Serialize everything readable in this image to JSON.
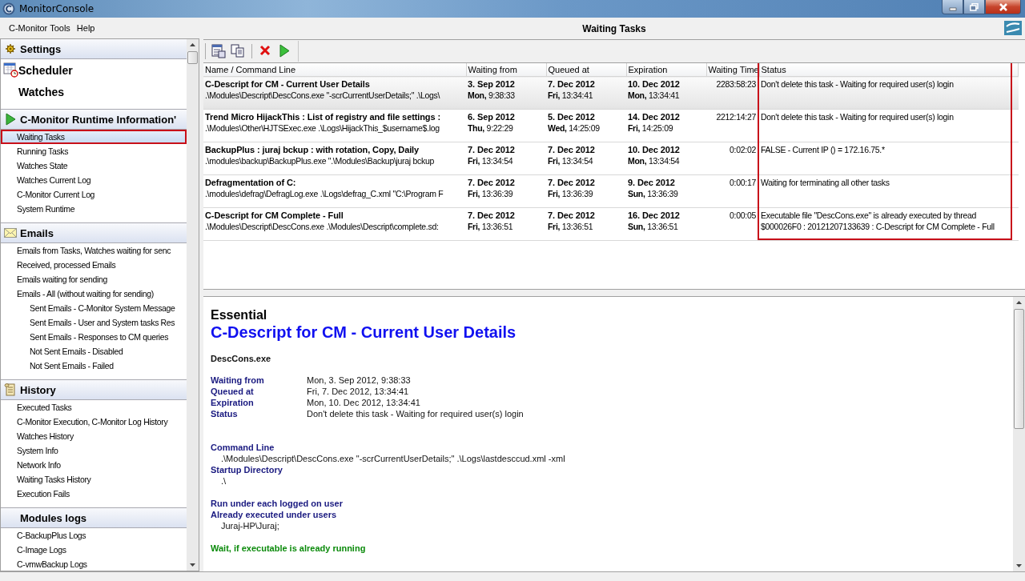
{
  "window": {
    "title": "MonitorConsole"
  },
  "menu": [
    "C-Monitor Tools",
    "Help"
  ],
  "sidebar": {
    "sections": [
      {
        "title": "Settings",
        "kind": "header"
      },
      {
        "title": "Scheduler",
        "kind": "link"
      },
      {
        "title": "Watches",
        "kind": "link"
      },
      {
        "title": "C-Monitor Runtime Information'",
        "kind": "header",
        "items": [
          {
            "label": "Waiting Tasks",
            "selected": true,
            "annotated": true
          },
          {
            "label": "Running Tasks",
            "selected": false,
            "annotated": false
          },
          {
            "label": "Watches State",
            "selected": false,
            "annotated": false
          },
          {
            "label": "Watches Current Log",
            "selected": false,
            "annotated": false
          },
          {
            "label": "C-Monitor Current Log",
            "selected": false,
            "annotated": false
          },
          {
            "label": "System Runtime",
            "selected": false,
            "annotated": false
          }
        ]
      },
      {
        "title": "Emails",
        "kind": "header",
        "items": [
          {
            "label": "Emails from Tasks, Watches waiting for senc",
            "selected": false,
            "annotated": false
          },
          {
            "label": "Received, processed Emails",
            "selected": false,
            "annotated": false
          },
          {
            "label": "Emails waiting for sending",
            "selected": false,
            "annotated": false
          },
          {
            "label": "Emails - All (without waiting for sending)",
            "selected": false,
            "annotated": false,
            "children": [
              {
                "label": "Sent Emails - C-Monitor System Message",
                "selected": false,
                "annotated": false
              },
              {
                "label": "Sent Emails - User and System tasks Res",
                "selected": false,
                "annotated": false
              },
              {
                "label": "Sent Emails - Responses to CM queries",
                "selected": false,
                "annotated": false
              },
              {
                "label": "Not Sent Emails - Disabled",
                "selected": false,
                "annotated": false
              },
              {
                "label": "Not Sent Emails - Failed",
                "selected": false,
                "annotated": false
              }
            ]
          }
        ]
      },
      {
        "title": "History",
        "kind": "header",
        "items": [
          {
            "label": "Executed Tasks",
            "selected": false,
            "annotated": false
          },
          {
            "label": "C-Monitor Execution, C-Monitor Log History",
            "selected": false,
            "annotated": false
          },
          {
            "label": "Watches History",
            "selected": false,
            "annotated": false
          },
          {
            "label": "System Info",
            "selected": false,
            "annotated": false
          },
          {
            "label": "Network Info",
            "selected": false,
            "annotated": false
          },
          {
            "label": "Waiting Tasks History",
            "selected": false,
            "annotated": false
          },
          {
            "label": "Execution Fails",
            "selected": false,
            "annotated": false
          }
        ]
      },
      {
        "title": "Modules logs",
        "kind": "header",
        "items": [
          {
            "label": "C-BackupPlus Logs",
            "selected": false,
            "annotated": false
          },
          {
            "label": "C-Image Logs",
            "selected": false,
            "annotated": false
          },
          {
            "label": "C-vmwBackup Logs",
            "selected": false,
            "annotated": false
          }
        ]
      }
    ]
  },
  "panel": {
    "title": "Waiting Tasks"
  },
  "toolbar": [
    {
      "kind": "properties"
    },
    {
      "kind": "copy"
    },
    {
      "kind": "delete"
    },
    {
      "kind": "run"
    }
  ],
  "table": {
    "columns": [
      {
        "label": "Name / Command Line",
        "annotated": false
      },
      {
        "label": "Waiting from",
        "annotated": false
      },
      {
        "label": "Queued at",
        "annotated": false
      },
      {
        "label": "Expiration",
        "annotated": false
      },
      {
        "label": "Waiting Time",
        "annotated": false
      },
      {
        "label": "Status",
        "annotated": true
      }
    ],
    "rows": [
      {
        "selected": true,
        "name": "C-Descript for CM - Current User Details",
        "command": ".\\Modules\\Descript\\DescCons.exe \"-scrCurrentUserDetails;\" .\\Logs\\",
        "waiting_from": [
          "3. Sep 2012",
          "**Mon,** 9:38:33"
        ],
        "queued_at": [
          "7. Dec 2012",
          "**Fri,** 13:34:41"
        ],
        "expiration": [
          "10. Dec 2012",
          "**Mon,** 13:34:41"
        ],
        "waiting_time": "2283:58:23",
        "status": "Don't delete this task - Waiting for required user(s) login"
      },
      {
        "selected": false,
        "name": "Trend Micro HijackThis : List of registry and file settings :",
        "command": ".\\Modules\\Other\\HJTSExec.exe .\\Logs\\HijackThis_$username$.log",
        "waiting_from": [
          "6. Sep 2012",
          "**Thu,** 9:22:29"
        ],
        "queued_at": [
          "5. Dec 2012",
          "**Wed,** 14:25:09"
        ],
        "expiration": [
          "14. Dec 2012",
          "**Fri,** 14:25:09"
        ],
        "waiting_time": "2212:14:27",
        "status": "Don't delete this task - Waiting for required user(s) login"
      },
      {
        "selected": false,
        "name": "BackupPlus : juraj bckup : with rotation, Copy, Daily",
        "command": ".\\modules\\backup\\BackupPlus.exe \".\\Modules\\Backup\\juraj bckup",
        "waiting_from": [
          "7. Dec 2012",
          "**Fri,** 13:34:54"
        ],
        "queued_at": [
          "7. Dec 2012",
          "**Fri,** 13:34:54"
        ],
        "expiration": [
          "10. Dec 2012",
          "**Mon,** 13:34:54"
        ],
        "waiting_time": "0:02:02",
        "status": "FALSE - Current IP () = 172.16.75.*"
      },
      {
        "selected": false,
        "name": "Defragmentation of C:",
        "command": ".\\modules\\defrag\\DefragLog.exe .\\Logs\\defrag_C.xml \"C:\\Program F",
        "waiting_from": [
          "7. Dec 2012",
          "**Fri,** 13:36:39"
        ],
        "queued_at": [
          "7. Dec 2012",
          "**Fri,** 13:36:39"
        ],
        "expiration": [
          "9. Dec 2012",
          "**Sun,** 13:36:39"
        ],
        "waiting_time": "0:00:17",
        "status": "Waiting for terminating all other tasks"
      },
      {
        "selected": false,
        "name": "C-Descript for CM Complete - Full",
        "command": ".\\Modules\\Descript\\DescCons.exe .\\Modules\\Descript\\complete.sd:",
        "waiting_from": [
          "7. Dec 2012",
          "**Fri,** 13:36:51"
        ],
        "queued_at": [
          "7. Dec 2012",
          "**Fri,** 13:36:51"
        ],
        "expiration": [
          "16. Dec 2012",
          "**Sun,** 13:36:51"
        ],
        "waiting_time": "0:00:05",
        "status": "Executable file \"DescCons.exe\" is already executed by thread $000026F0 : 20121207133639 : C-Descript for CM Complete - Full"
      }
    ]
  },
  "detail": {
    "category": "Essential",
    "title": "C-Descript for CM - Current User Details",
    "executable": "DescCons.exe",
    "fields": [
      {
        "label": "Waiting from",
        "value": "Mon, 3. Sep 2012, 9:38:33"
      },
      {
        "label": "Queued at",
        "value": "Fri, 7. Dec 2012, 13:34:41"
      },
      {
        "label": "Expiration",
        "value": "Mon, 10. Dec 2012, 13:34:41"
      },
      {
        "label": "Status",
        "value": "Don't delete this task - Waiting for required user(s) login"
      }
    ],
    "blocks": [
      {
        "kind": "field",
        "label": "Command Line",
        "value": ".\\Modules\\Descript\\DescCons.exe \"-scrCurrentUserDetails;\" .\\Logs\\lastdesccud.xml -xml"
      },
      {
        "kind": "field",
        "label": "Startup Directory",
        "value": ".\\"
      },
      {
        "kind": "flag",
        "label": "Run under each logged on user"
      },
      {
        "kind": "field",
        "label": "Already executed under users",
        "value": "Juraj-HP\\Juraj;"
      },
      {
        "kind": "warning",
        "label": "Wait, if executable is already running"
      }
    ]
  }
}
